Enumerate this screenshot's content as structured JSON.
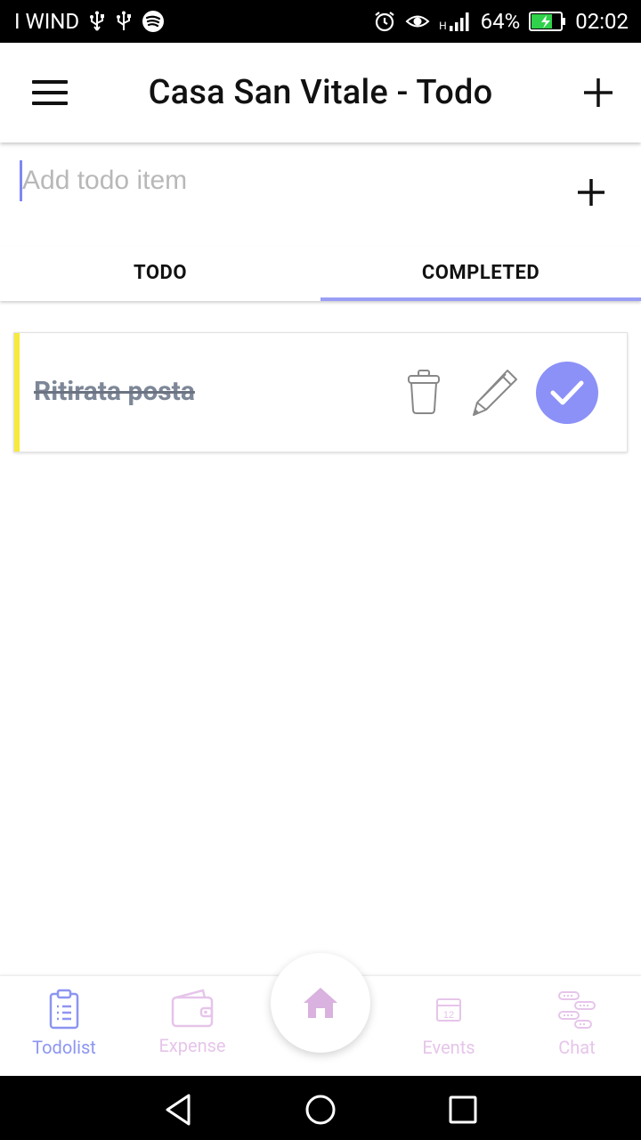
{
  "status_bar": {
    "carrier": "I WIND",
    "network": "H",
    "battery": "64%",
    "time": "02:02"
  },
  "app_bar": {
    "title": "Casa San Vitale - Todo",
    "menu_icon": "menu-icon",
    "add_icon": "plus-icon"
  },
  "add_todo": {
    "placeholder": "Add todo item",
    "value": ""
  },
  "tabs": [
    {
      "label": "TODO",
      "active": false
    },
    {
      "label": "COMPLETED",
      "active": true
    }
  ],
  "todos": [
    {
      "text": "Ritirata posta",
      "completed": true,
      "accent_color": "#f7ea3a"
    }
  ],
  "bottom_nav": {
    "items": [
      {
        "label": "Todolist",
        "icon": "clipboard-icon",
        "color": "#8c95f2"
      },
      {
        "label": "Expense",
        "icon": "wallet-icon",
        "color": "#e6c5ea"
      },
      {
        "label": "Events",
        "icon": "calendar-icon",
        "color": "#e6c5ea"
      },
      {
        "label": "Chat",
        "icon": "chat-icon",
        "color": "#e6c5ea"
      }
    ],
    "home_icon": "home-icon",
    "calendar_day": "12"
  },
  "colors": {
    "accent": "#8c91f7",
    "tab_indicator": "#9a9ff5",
    "todo_accent": "#f7ea3a",
    "inactive_nav": "#e6c5ea"
  }
}
